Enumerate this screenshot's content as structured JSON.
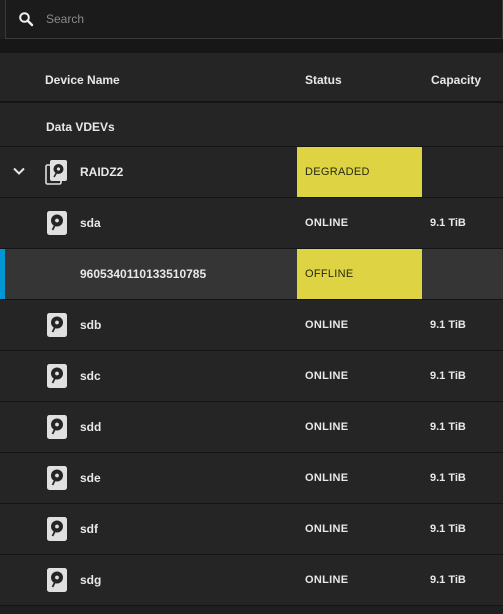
{
  "search": {
    "placeholder": "Search"
  },
  "columns": {
    "name": "Device Name",
    "status": "Status",
    "capacity": "Capacity"
  },
  "group": {
    "label": "Data VDEVs"
  },
  "colors": {
    "accent": "#0095d5",
    "warning": "#ded343"
  },
  "rows": [
    {
      "name": "RAIDZ2",
      "status": "DEGRADED",
      "capacity": "",
      "icon": "disk-stack-icon",
      "expandable": true
    },
    {
      "name": "sda",
      "status": "ONLINE",
      "capacity": "9.1 TiB",
      "icon": "hard-disk-icon"
    },
    {
      "name": "9605340110133510785",
      "status": "OFFLINE",
      "capacity": "",
      "icon": "",
      "selected": true
    },
    {
      "name": "sdb",
      "status": "ONLINE",
      "capacity": "9.1 TiB",
      "icon": "hard-disk-icon"
    },
    {
      "name": "sdc",
      "status": "ONLINE",
      "capacity": "9.1 TiB",
      "icon": "hard-disk-icon"
    },
    {
      "name": "sdd",
      "status": "ONLINE",
      "capacity": "9.1 TiB",
      "icon": "hard-disk-icon"
    },
    {
      "name": "sde",
      "status": "ONLINE",
      "capacity": "9.1 TiB",
      "icon": "hard-disk-icon"
    },
    {
      "name": "sdf",
      "status": "ONLINE",
      "capacity": "9.1 TiB",
      "icon": "hard-disk-icon"
    },
    {
      "name": "sdg",
      "status": "ONLINE",
      "capacity": "9.1 TiB",
      "icon": "hard-disk-icon"
    }
  ]
}
